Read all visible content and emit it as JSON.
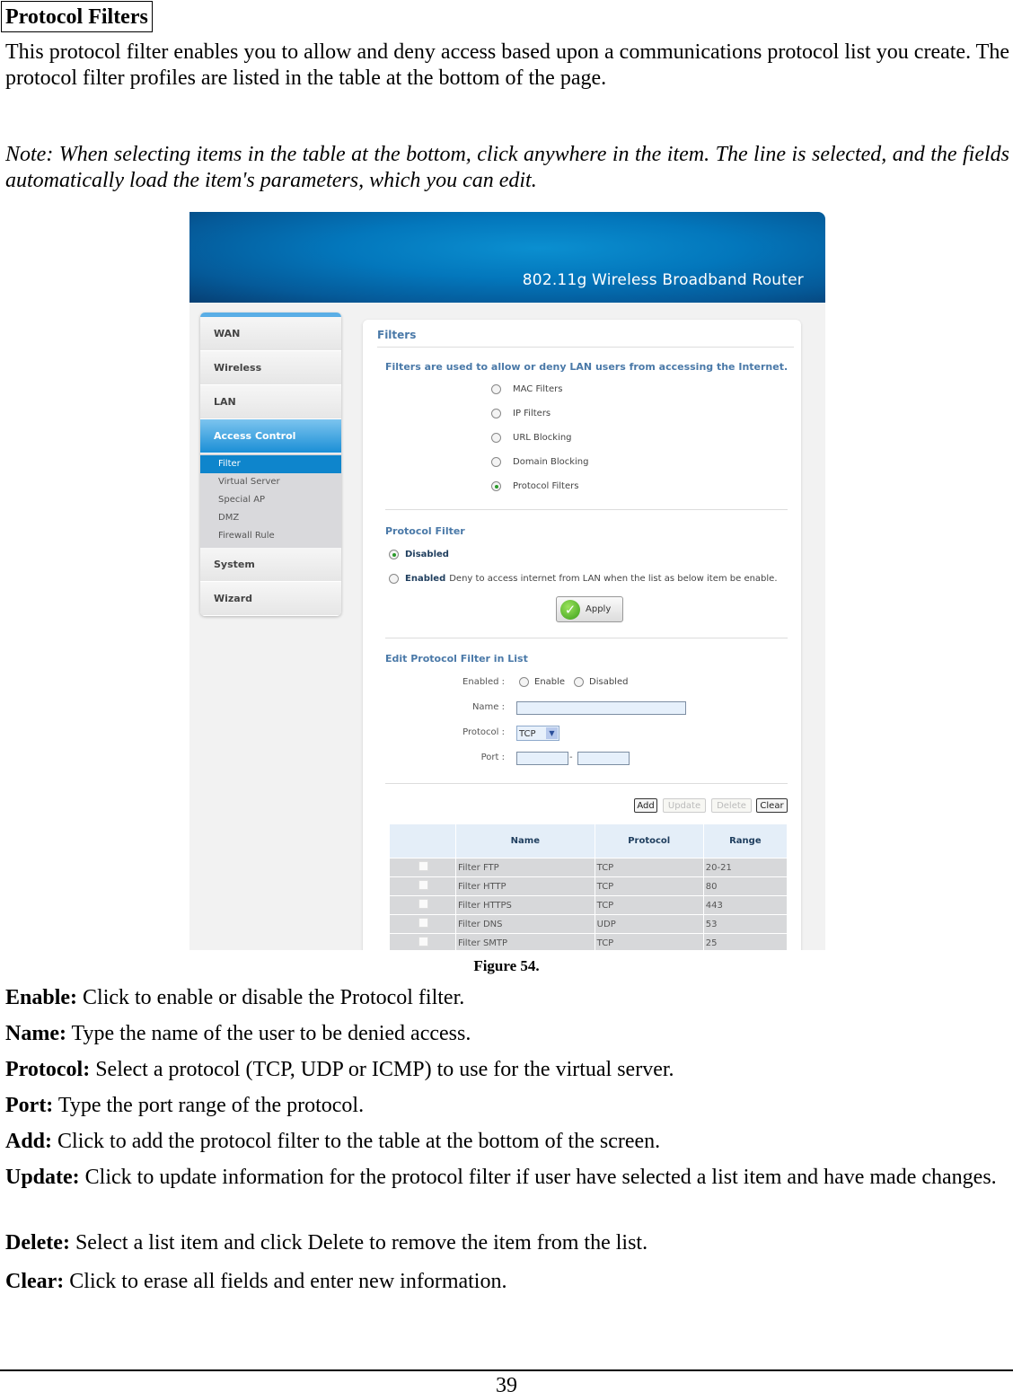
{
  "document": {
    "section_title": "Protocol Filters",
    "intro": "This protocol filter enables you to allow and deny access based upon a communications protocol list you create. The protocol filter profiles are listed in the table at the bottom of the page.",
    "note": "Note: When selecting items in the table at the bottom, click anywhere in the item. The line is selected, and the fields automatically load the item's parameters, which you can edit.",
    "figure_caption": "Figure 54.",
    "descriptions": [
      {
        "term": "Enable:",
        "text": " Click to enable or disable the Protocol filter."
      },
      {
        "term": "Name:",
        "text": " Type the name of the user to be denied access."
      },
      {
        "term": "Protocol:",
        "text": " Select a protocol (TCP, UDP or ICMP) to use for the virtual server."
      },
      {
        "term": "Port:",
        "text": " Type the port range of the protocol."
      },
      {
        "term": "Add:",
        "text": " Click to add the protocol filter to the table at the bottom of the screen."
      },
      {
        "term": "Update:",
        "text": " Click to update information for the protocol filter if user have selected a list item and have made changes."
      },
      {
        "term": "Delete:",
        "text": " Select a list item and click Delete to remove the item from the list."
      },
      {
        "term": "Clear:",
        "text": " Click to erase all fields and enter new information."
      }
    ],
    "page_number": "39"
  },
  "router_ui": {
    "banner_title": "802.11g Wireless Broadband Router",
    "colors": {
      "accent_blue": "#0e85cc",
      "heading_blue": "#4a79a8",
      "apply_green": "#3a9e1a"
    },
    "sidebar": {
      "items": [
        {
          "label": "WAN"
        },
        {
          "label": "Wireless"
        },
        {
          "label": "LAN"
        },
        {
          "label": "Access Control",
          "active": true
        }
      ],
      "subitems": [
        {
          "label": "Filter",
          "active": true
        },
        {
          "label": "Virtual Server"
        },
        {
          "label": "Special AP"
        },
        {
          "label": "DMZ"
        },
        {
          "label": "Firewall Rule"
        }
      ],
      "bottom_items": [
        {
          "label": "System"
        },
        {
          "label": "Wizard"
        }
      ]
    },
    "filters": {
      "title": "Filters",
      "description": "Filters are used to allow or deny LAN users from accessing the Internet.",
      "options": [
        {
          "label": "MAC Filters",
          "selected": false
        },
        {
          "label": "IP Filters",
          "selected": false
        },
        {
          "label": "URL Blocking",
          "selected": false
        },
        {
          "label": "Domain Blocking",
          "selected": false
        },
        {
          "label": "Protocol Filters",
          "selected": true
        }
      ]
    },
    "protocol_filter": {
      "title": "Protocol Filter",
      "disabled_label": "Disabled",
      "enabled_label": "Enabled",
      "enabled_note": "Deny to access internet from LAN when the list as below item be enable.",
      "selected": "Disabled",
      "apply_label": "Apply"
    },
    "edit": {
      "title": "Edit Protocol Filter in List",
      "enabled_label": "Enabled :",
      "enable_option": "Enable",
      "disabled_option": "Disabled",
      "name_label": "Name :",
      "name_value": "",
      "protocol_label": "Protocol :",
      "protocol_value": "TCP",
      "port_label": "Port :",
      "port_from": "",
      "port_separator": "-",
      "port_to": "",
      "buttons": {
        "add": "Add",
        "update": "Update",
        "delete": "Delete",
        "clear": "Clear"
      }
    },
    "table": {
      "headers": [
        "",
        "Name",
        "Protocol",
        "Range"
      ],
      "rows": [
        {
          "name": "Filter FTP",
          "protocol": "TCP",
          "range": "20-21"
        },
        {
          "name": "Filter HTTP",
          "protocol": "TCP",
          "range": "80"
        },
        {
          "name": "Filter HTTPS",
          "protocol": "TCP",
          "range": "443"
        },
        {
          "name": "Filter DNS",
          "protocol": "UDP",
          "range": "53"
        },
        {
          "name": "Filter SMTP",
          "protocol": "TCP",
          "range": "25"
        }
      ]
    }
  }
}
